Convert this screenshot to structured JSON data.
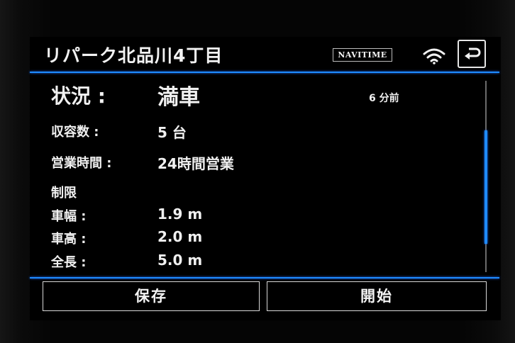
{
  "header": {
    "title": "リパーク北品川4丁目",
    "brand": "NAVITIME",
    "wifi_icon": "wifi-icon",
    "back_icon": "back-arrow-icon"
  },
  "status": {
    "label": "状況 :",
    "value": "満車",
    "updated": "6 分前"
  },
  "capacity": {
    "label": "収容数 :",
    "value": "5 台"
  },
  "hours": {
    "label": "営業時間 :",
    "value": "24時間営業"
  },
  "limits": {
    "heading": "制限",
    "width_label": "車幅 :",
    "width_value": "1.9 m",
    "height_label": "車高 :",
    "height_value": "2.0 m",
    "length_label": "全長 :",
    "length_value": "5.0 m"
  },
  "actions": {
    "save_label": "保存",
    "start_label": "開始"
  },
  "colors": {
    "accent": "#1e8bff",
    "text": "#f0f0f0",
    "background": "#000000"
  }
}
